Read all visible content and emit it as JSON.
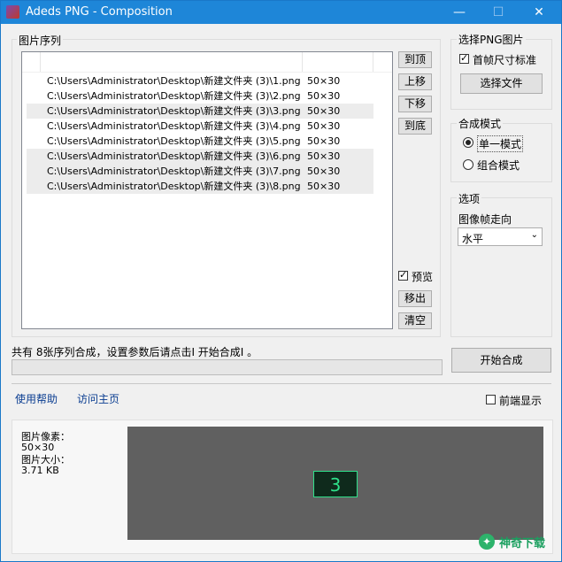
{
  "window": {
    "title": "Adeds PNG - Composition",
    "min_glyph": "—",
    "max_glyph": "☐",
    "close_glyph": "✕"
  },
  "sequence": {
    "label": "图片序列",
    "rows": [
      {
        "path": "C:\\Users\\Administrator\\Desktop\\新建文件夹 (3)\\1.png",
        "size": "50×30"
      },
      {
        "path": "C:\\Users\\Administrator\\Desktop\\新建文件夹 (3)\\2.png",
        "size": "50×30"
      },
      {
        "path": "C:\\Users\\Administrator\\Desktop\\新建文件夹 (3)\\3.png",
        "size": "50×30"
      },
      {
        "path": "C:\\Users\\Administrator\\Desktop\\新建文件夹 (3)\\4.png",
        "size": "50×30"
      },
      {
        "path": "C:\\Users\\Administrator\\Desktop\\新建文件夹 (3)\\5.png",
        "size": "50×30"
      },
      {
        "path": "C:\\Users\\Administrator\\Desktop\\新建文件夹 (3)\\6.png",
        "size": "50×30"
      },
      {
        "path": "C:\\Users\\Administrator\\Desktop\\新建文件夹 (3)\\7.png",
        "size": "50×30"
      },
      {
        "path": "C:\\Users\\Administrator\\Desktop\\新建文件夹 (3)\\8.png",
        "size": "50×30"
      }
    ],
    "buttons": {
      "top": "到顶",
      "up": "上移",
      "down": "下移",
      "bottom": "到底",
      "remove": "移出",
      "clear": "清空"
    },
    "preview_label": "预览",
    "preview_checked": true
  },
  "select_png": {
    "label": "选择PNG图片",
    "first_frame_label": "首帧尺寸标准",
    "first_frame_checked": true,
    "choose_button": "选择文件"
  },
  "mode": {
    "label": "合成模式",
    "single": "单一模式",
    "combined": "组合模式",
    "selected": "single"
  },
  "options": {
    "label": "选项",
    "direction_label": "图像帧走向",
    "direction_value": "水平"
  },
  "status": {
    "text": "共有 8张序列合成，设置参数后请点击Ⅰ 开始合成Ⅰ 。",
    "progress": 0,
    "start_button": "开始合成"
  },
  "links": {
    "help": "使用帮助",
    "home": "访问主页"
  },
  "topmost": {
    "label": "前端显示",
    "checked": false
  },
  "preview": {
    "pixels_label": "图片像素：",
    "pixels_value": "50×30",
    "size_label": "图片大小：",
    "size_value": "3.71 KB",
    "frame_number": "3"
  },
  "watermark": {
    "text": "神奇下载"
  },
  "colors": {
    "titlebar": "#1e86d8",
    "canvas_bg": "#606060",
    "frame_accent": "#2fe08a"
  }
}
